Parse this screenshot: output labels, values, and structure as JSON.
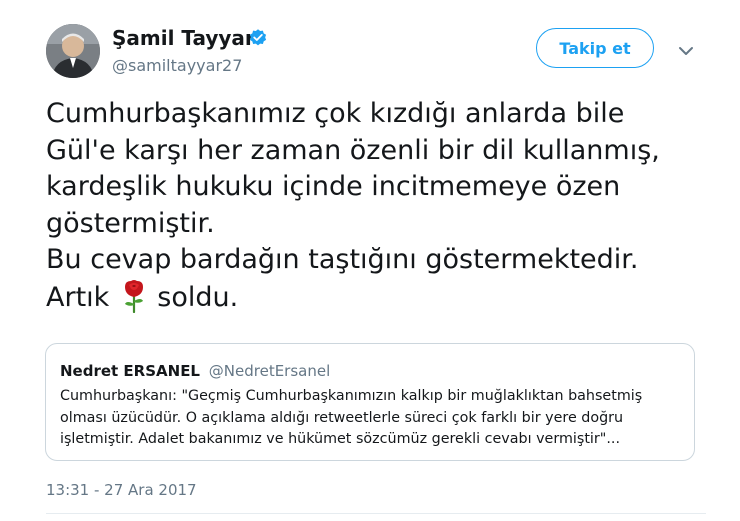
{
  "author": {
    "display_name": "Şamil Tayyar",
    "username": "@samiltayyar27",
    "verified": true,
    "avatar_icon": "profile-photo"
  },
  "actions": {
    "follow_label": "Takip et",
    "more_icon": "chevron-down-icon"
  },
  "tweet": {
    "lines": [
      "Cumhurbaşkanımız çok kızdığı anlarda bile",
      "Gül'e karşı her zaman özenli bir dil kullanmış,",
      "kardeşlik hukuku içinde incitmemeye özen",
      "göstermiştir.",
      "Bu cevap bardağın taştığını göstermektedir."
    ],
    "last_line_before": "Artık",
    "last_line_emoji": "rose-icon",
    "last_line_after": "soldu."
  },
  "quote": {
    "name": "Nedret ERSANEL",
    "handle": "@NedretErsanel",
    "lines": [
      "Cumhurbaşkanı: \"Geçmiş Cumhurbaşkanımızın kalkıp bir muğlaklıktan bahsetmiş",
      "olması üzücüdür. O açıklama aldığı retweetlerle süreci çok farklı bir yere doğru",
      "işletmiştir. Adalet bakanımız ve hükümet sözcümüz gerekli cevabı vermiştir\"..."
    ]
  },
  "timestamp": "13:31 - 27 Ara 2017",
  "colors": {
    "accent": "#1da1f2",
    "text": "#14171a",
    "muted": "#657786",
    "border": "#ccd6dd"
  }
}
